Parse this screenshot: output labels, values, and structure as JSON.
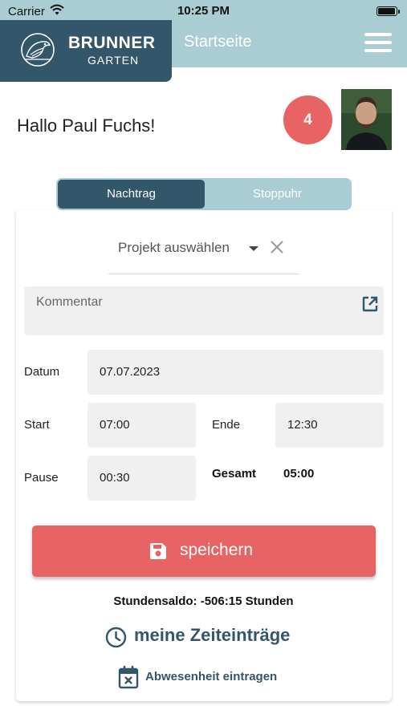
{
  "status_bar": {
    "carrier": "Carrier",
    "time": "10:25 PM",
    "battery_level": 1.0
  },
  "header": {
    "brand_name": "BRUNNER",
    "brand_sub": "GARTEN",
    "title": "Startseite",
    "menu_icon": "hamburger-menu-icon"
  },
  "greeting": {
    "text": "Hallo Paul Fuchs!",
    "notification_count": "4"
  },
  "tabs": [
    {
      "label": "Nachtrag",
      "active": true
    },
    {
      "label": "Stoppuhr",
      "active": false
    }
  ],
  "form": {
    "project_placeholder": "Projekt auswählen",
    "comment_placeholder": "Kommentar",
    "date_label": "Datum",
    "date_value": "07.07.2023",
    "start_label": "Start",
    "start_value": "07:00",
    "end_label": "Ende",
    "end_value": "12:30",
    "pause_label": "Pause",
    "pause_value": "00:30",
    "total_label": "Gesamt",
    "total_value": "05:00",
    "save_label": "speichern"
  },
  "footer": {
    "saldo": "Stundensaldo: -506:15 Stunden",
    "entries_link": "meine Zeiteinträge",
    "absence_link": "Abwesenheit eintragen"
  },
  "colors": {
    "brand_dark": "#34566a",
    "brand_light": "#a9cdd2",
    "accent_red": "#e86464",
    "field_bg": "#f0f0f0"
  }
}
